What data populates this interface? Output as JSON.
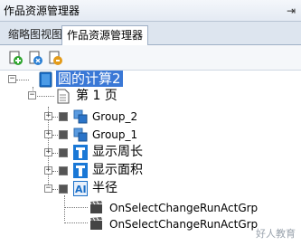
{
  "panel": {
    "title": "作品资源管理器",
    "pin_symbol": "⇥"
  },
  "tabs": [
    {
      "label": "缩略图视图"
    },
    {
      "label": "作品资源管理器"
    }
  ],
  "toolbar": {
    "buttons": [
      "add-green-page-icon",
      "add-blue-page-icon",
      "add-orange-page-icon"
    ]
  },
  "tree": {
    "root": {
      "label": "圆的计算2"
    },
    "page": {
      "label": "第 1 页"
    },
    "items": [
      {
        "label": "Group_2"
      },
      {
        "label": "Group_1"
      },
      {
        "label": "显示周长"
      },
      {
        "label": "显示面积"
      },
      {
        "label": "半径"
      }
    ],
    "actions": [
      {
        "label": "OnSelectChangeRunActGrp"
      },
      {
        "label": "OnSelectChangeRunActGrp"
      }
    ]
  },
  "watermark": "好人教育",
  "colors": {
    "selected": "#3a78d6",
    "accent_blue": "#1a6fc8"
  }
}
